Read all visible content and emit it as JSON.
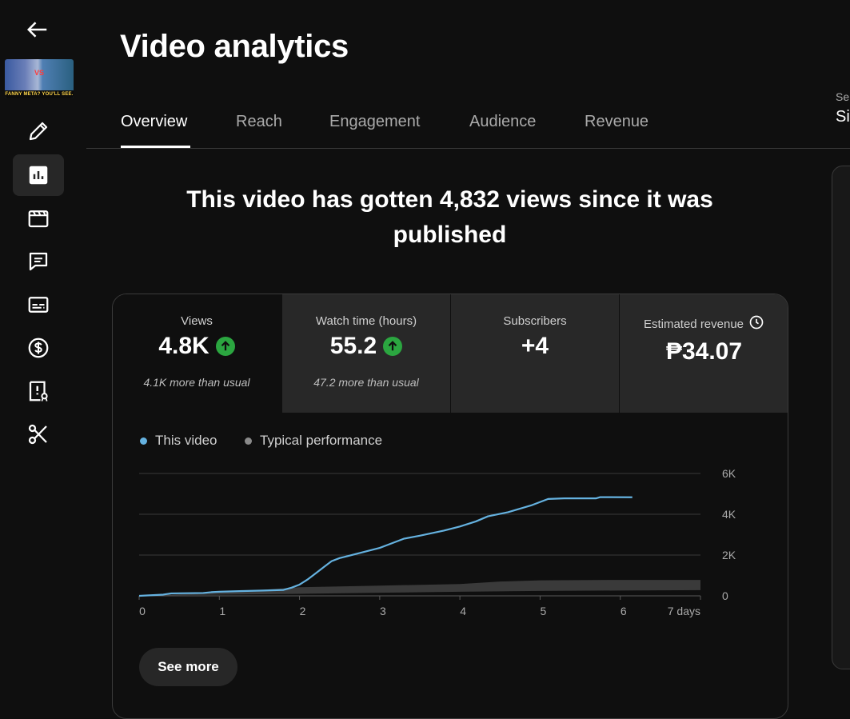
{
  "page": {
    "title": "Video analytics"
  },
  "thumbnail": {
    "caption": "FANNY META? YOU'LL SEE.",
    "badge": "VS"
  },
  "tabs": [
    {
      "label": "Overview",
      "active": true
    },
    {
      "label": "Reach",
      "active": false
    },
    {
      "label": "Engagement",
      "active": false
    },
    {
      "label": "Audience",
      "active": false
    },
    {
      "label": "Revenue",
      "active": false
    }
  ],
  "right_panel": {
    "label_fragment": "Se",
    "value_fragment": "Si"
  },
  "headline": "This video has gotten 4,832 views since it was published",
  "metrics": [
    {
      "label": "Views",
      "value": "4.8K",
      "trend": "up",
      "note": "4.1K more than usual"
    },
    {
      "label": "Watch time (hours)",
      "value": "55.2",
      "trend": "up",
      "note": "47.2 more than usual"
    },
    {
      "label": "Subscribers",
      "value": "+4",
      "trend": "",
      "note": ""
    },
    {
      "label": "Estimated revenue",
      "value": "₱34.07",
      "trend": "",
      "note": "",
      "icon": "clock-icon"
    }
  ],
  "see_more": "See more",
  "colors": {
    "this_video": "#65b2e0",
    "typical": "#3a3a3a",
    "up_badge": "#2ba640"
  },
  "sidebar_icons": [
    "back-arrow-icon",
    "pencil-icon",
    "analytics-icon",
    "clapperboard-icon",
    "comments-icon",
    "subtitles-icon",
    "dollar-icon",
    "copyright-alert-icon",
    "scissors-icon"
  ],
  "chart_data": {
    "type": "line",
    "legend": [
      "This video",
      "Typical performance"
    ],
    "x_ticks": [
      "0",
      "1",
      "2",
      "3",
      "4",
      "5",
      "6",
      "7 days"
    ],
    "y_ticks": [
      "0",
      "2K",
      "4K",
      "6K"
    ],
    "xlim": [
      0,
      7
    ],
    "ylim": [
      0,
      6000
    ],
    "grid": true,
    "series": [
      {
        "name": "This video",
        "x": [
          0,
          0.3,
          0.4,
          0.8,
          0.9,
          1.0,
          1.25,
          1.55,
          1.8,
          1.9,
          2.0,
          2.1,
          2.2,
          2.3,
          2.4,
          2.5,
          2.6,
          2.8,
          3.0,
          3.1,
          3.3,
          3.5,
          3.8,
          4.0,
          4.2,
          4.35,
          4.6,
          4.9,
          5.1,
          5.3,
          5.7,
          5.75,
          6.15
        ],
        "y": [
          0,
          60,
          120,
          140,
          180,
          200,
          230,
          260,
          290,
          400,
          550,
          800,
          1100,
          1400,
          1700,
          1850,
          1950,
          2150,
          2350,
          2500,
          2800,
          2950,
          3200,
          3400,
          3650,
          3900,
          4100,
          4450,
          4750,
          4780,
          4780,
          4840,
          4832
        ]
      },
      {
        "name": "Typical performance",
        "x": [
          0,
          1,
          2,
          3,
          4,
          4.5,
          5,
          6,
          7
        ],
        "y_low": [
          0,
          60,
          100,
          150,
          200,
          220,
          240,
          260,
          280
        ],
        "y_high": [
          0,
          150,
          420,
          500,
          580,
          700,
          760,
          780,
          780
        ]
      }
    ]
  }
}
